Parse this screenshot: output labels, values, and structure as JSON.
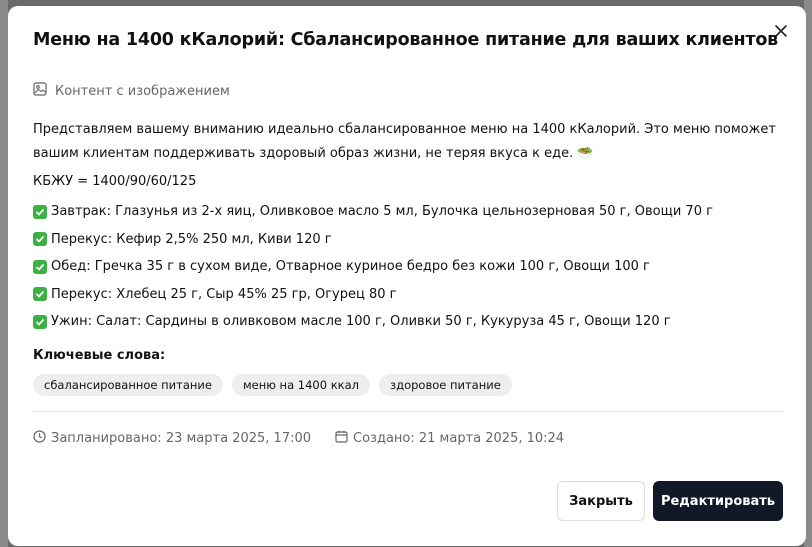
{
  "modal": {
    "title": "Меню на 1400 кКалорий: Сбалансированное питание для ваших клиентов",
    "image_content_label": "Контент с изображением",
    "intro": "Представляем вашему вниманию идеально сбалансированное меню на 1400 кКалорий. Это меню поможет вашим клиентам поддерживать здоровый образ жизни, не теряя вкуса к еде. 🥗",
    "kbju": "КБЖУ = 1400/90/60/125",
    "meals": [
      "Завтрак: Глазунья из 2-х яиц, Оливковое масло 5 мл, Булочка цельнозерновая 50 г, Овощи 70 г",
      "Перекус: Кефир 2,5% 250 мл, Киви 120 г",
      "Обед: Гречка 35 г в сухом виде, Отварное куриное бедро без кожи 100 г, Овощи 100 г",
      "Перекус: Хлебец 25 г, Сыр 45% 25 гр, Огурец 80 г",
      "Ужин: Салат: Сардины в оливковом масле 100 г, Оливки 50 г, Кукуруза 45 г, Овощи 120 г"
    ],
    "keywords_title": "Ключевые слова:",
    "keywords": [
      "сбалансированное питание",
      "меню на 1400 ккал",
      "здоровое питание"
    ],
    "scheduled": "Запланировано: 23 марта 2025, 17:00",
    "created": "Создано: 21 марта 2025, 10:24",
    "close_button": "Закрыть",
    "edit_button": "Редактировать"
  },
  "icons": {
    "close": "close-icon",
    "image": "image-icon",
    "check": "check-icon",
    "clock": "clock-icon",
    "calendar": "calendar-icon"
  },
  "colors": {
    "check_green": "#3cb043",
    "primary_button": "#111827",
    "muted_text": "#666666"
  }
}
